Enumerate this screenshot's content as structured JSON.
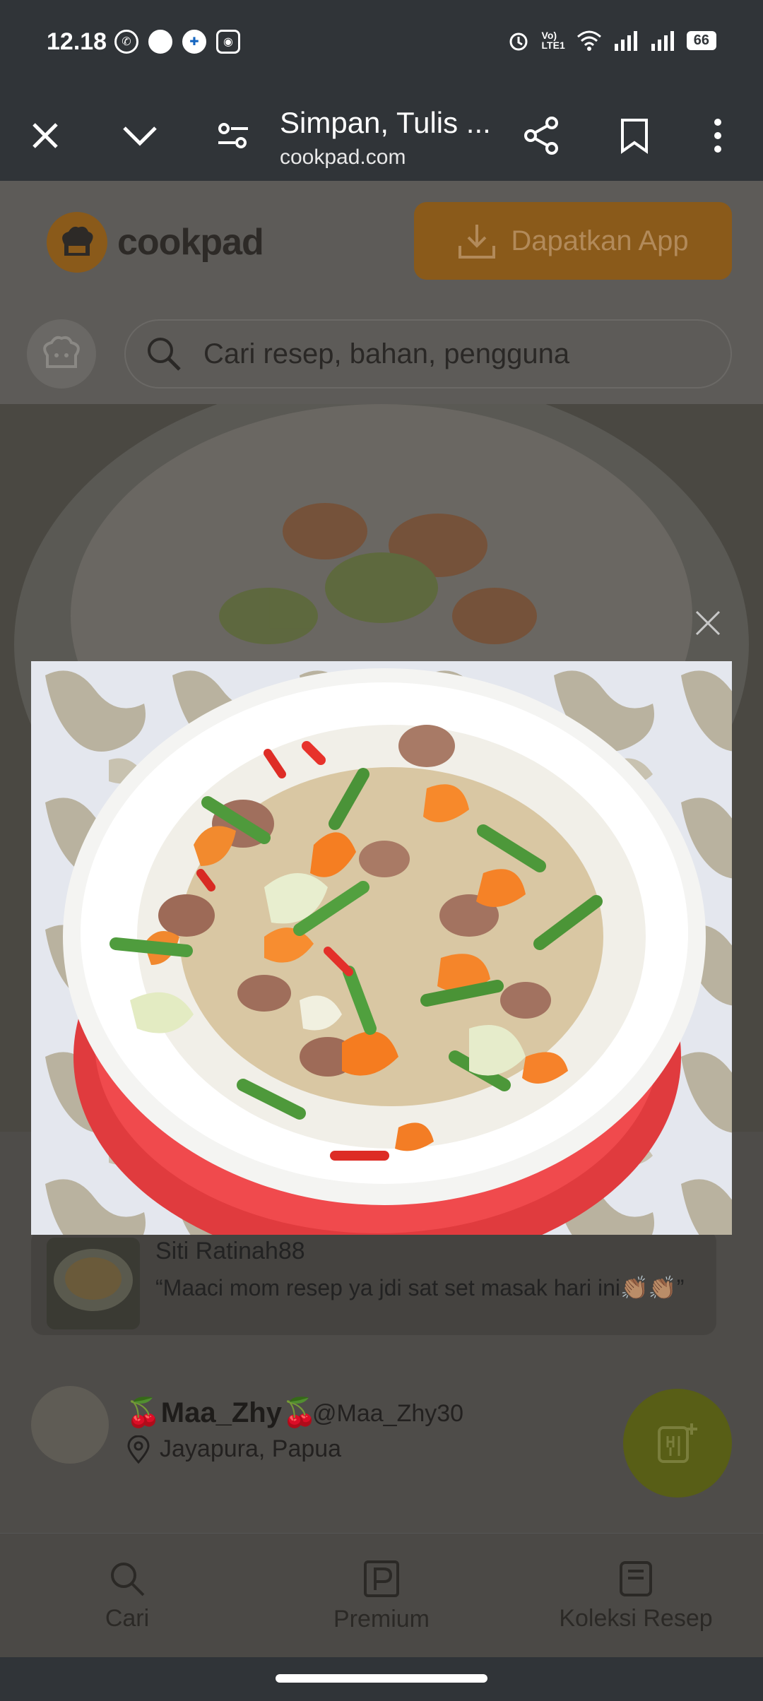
{
  "status_bar": {
    "time": "12.18",
    "battery": "66"
  },
  "toolbar": {
    "title": "Simpan, Tulis ...",
    "url": "cookpad.com"
  },
  "header": {
    "logo_text": "cookpad",
    "get_app_label": "Dapatkan App",
    "search_placeholder": "Cari resep, bahan, pengguna"
  },
  "comment": {
    "name": "Siti Ratinah88",
    "text": "“Maaci mom resep ya jdi sat set masak hari ini👏🏽👏🏽”"
  },
  "author": {
    "name": "🍒Maa_Zhy🍒",
    "handle": "@Maa_Zhy30",
    "location": "Jayapura, Papua"
  },
  "bottom_nav": {
    "search_label": "Cari",
    "premium_label": "Premium",
    "collection_label": "Koleksi Resep"
  },
  "colors": {
    "toolbar_bg": "#303438",
    "brand_orange": "#f99d1c",
    "fab_green": "#8e9a1e"
  }
}
